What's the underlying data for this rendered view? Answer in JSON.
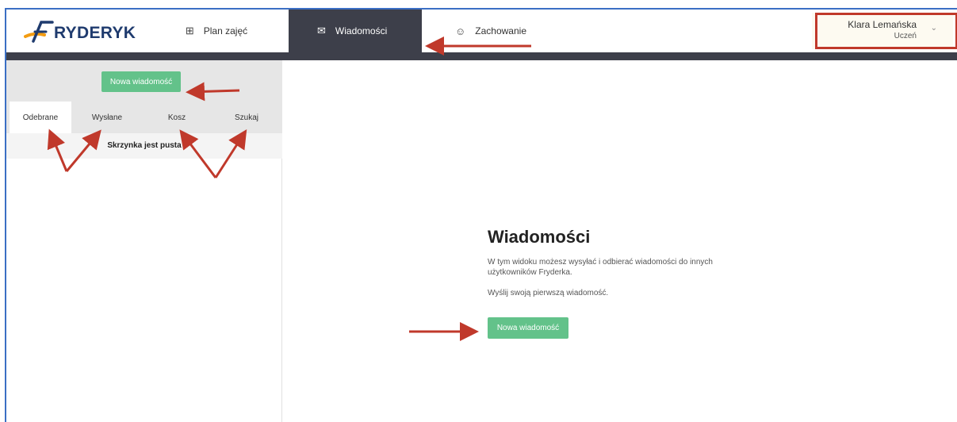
{
  "header": {
    "logo_text": "RYDERYK",
    "nav": [
      {
        "label": "Plan zajęć",
        "icon": "grid-icon"
      },
      {
        "label": "Wiadomości",
        "icon": "envelope-icon"
      },
      {
        "label": "Zachowanie",
        "icon": "smiley-icon"
      }
    ],
    "user": {
      "name": "Klara Lemańska",
      "role": "Uczeń"
    }
  },
  "sidebar": {
    "new_message_label": "Nowa wiadomość",
    "tabs": [
      "Odebrane",
      "Wysłane",
      "Kosz",
      "Szukaj"
    ],
    "empty_text": "Skrzynka jest pusta"
  },
  "main": {
    "title": "Wiadomości",
    "description": "W tym widoku możesz wysyłać i odbierać wiadomości do innych użytkowników Fryderka.",
    "prompt": "Wyślij swoją pierwszą wiadomość.",
    "new_message_label": "Nowa wiadomość"
  },
  "colors": {
    "accent": "#63c28a",
    "nav_dark": "#3d3f4a",
    "annotation": "#c0392b",
    "logo": "#1f3b6e"
  }
}
